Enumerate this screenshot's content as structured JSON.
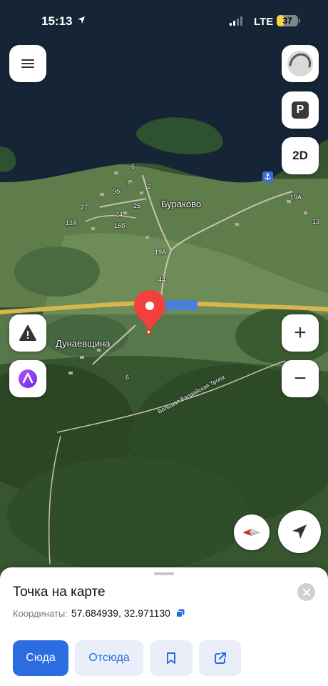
{
  "status_bar": {
    "time": "15:13",
    "network": "LTE",
    "battery_text": "37",
    "battery_percent": 37
  },
  "map": {
    "place_names": {
      "burakovo": "Бураково",
      "dunaevshchina": "Дунаевщина"
    },
    "road_name": "Большая Валдайская Тропа",
    "house_numbers": [
      "6",
      "7",
      "2",
      "9б",
      "27",
      "24",
      "25",
      "12А",
      "16б",
      "19А",
      "44",
      "19А",
      "13",
      "6"
    ],
    "poi_badge": "21",
    "colors": {
      "water": "#152536",
      "forest": "#2c4a26",
      "field": "#6a8a55",
      "road": "#d7b64f",
      "pin": "#f2403c"
    }
  },
  "controls": {
    "menu_icon": "menu-icon",
    "alice_sphere_icon": "voice-assistant-sphere-icon",
    "parking_label": "P",
    "view_mode_label": "2D",
    "zoom_in_label": "+",
    "zoom_out_label": "−",
    "report_icon": "warning-icon",
    "assistant_icon": "alice-icon",
    "compass_icon": "compass-icon",
    "locate_icon": "location-arrow-icon"
  },
  "sheet": {
    "title": "Точка на карте",
    "coords_label": "Координаты:",
    "coords_value": "57.684939, 32.971130",
    "buttons": {
      "here": "Сюда",
      "from": "Отсюда",
      "bookmark_icon": "bookmark-icon",
      "share_icon": "share-icon"
    },
    "accent_color": "#2b6de0"
  }
}
